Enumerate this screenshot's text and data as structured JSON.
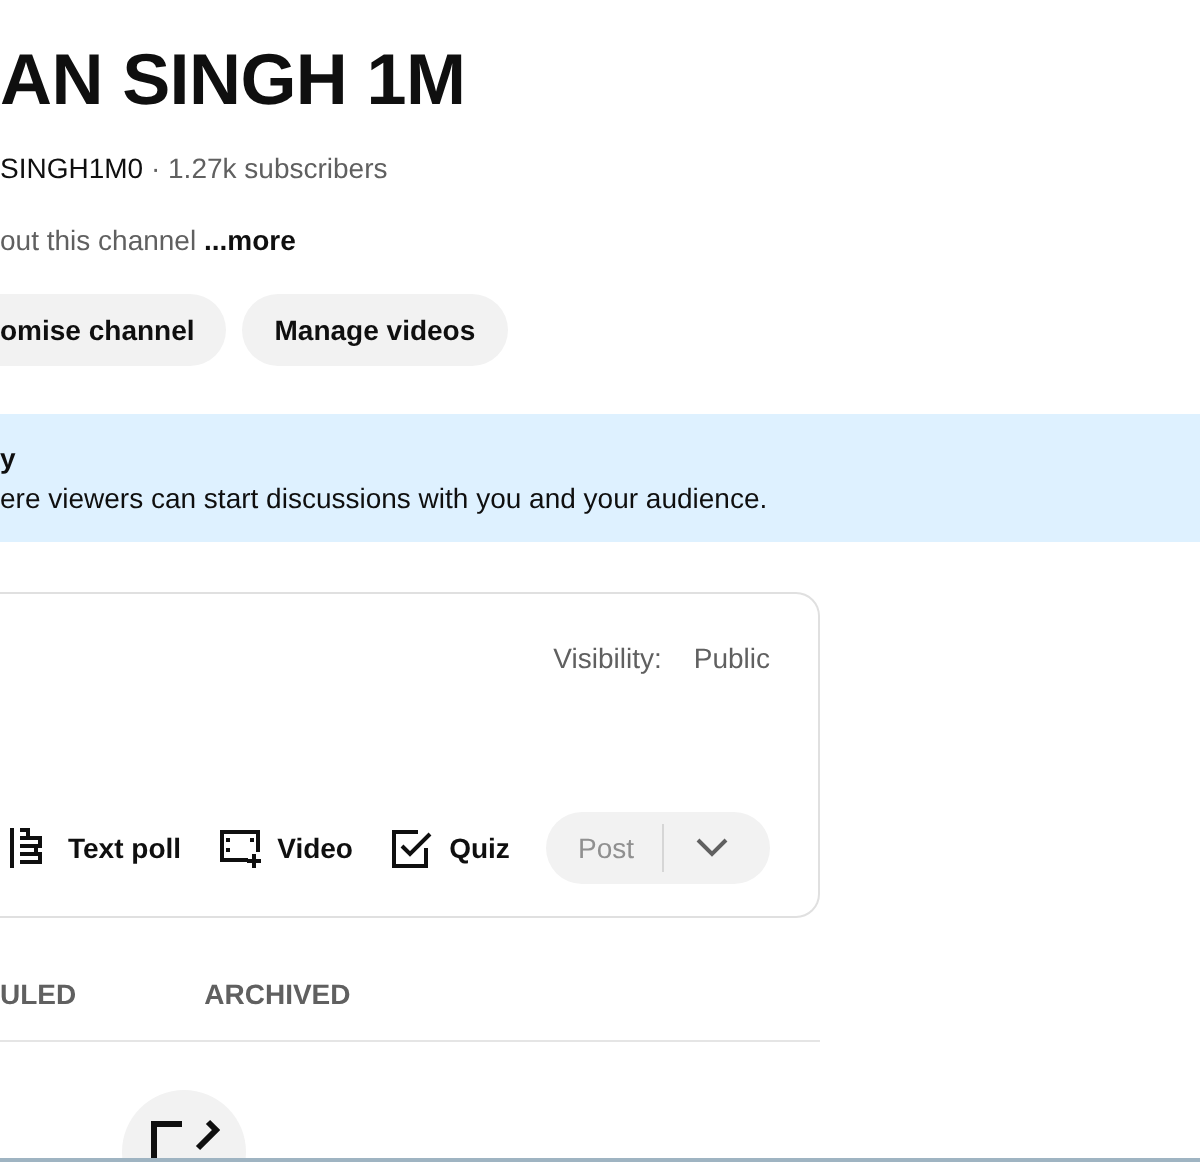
{
  "channel": {
    "name": "AN SINGH 1M",
    "handle": "SINGH1M0",
    "meta": " · 1.27k subscribers",
    "description": "out this channel",
    "more": "...more"
  },
  "buttons": [
    {
      "label": "omise channel"
    },
    {
      "label": "Manage videos"
    }
  ],
  "banner": {
    "title": "y",
    "text": "ere viewers can start discussions with you and your audience."
  },
  "composer": {
    "visibility_label": "Visibility:",
    "visibility_value": "Public",
    "tools": [
      {
        "kind": "poll",
        "label": "Text poll"
      },
      {
        "kind": "video",
        "label": "Video"
      },
      {
        "kind": "quiz",
        "label": "Quiz"
      }
    ],
    "post": {
      "label": "Post",
      "disabled": true
    }
  },
  "tabs": [
    {
      "label": "ULED",
      "selected": false
    },
    {
      "label": "ARCHIVED",
      "selected": false
    }
  ]
}
